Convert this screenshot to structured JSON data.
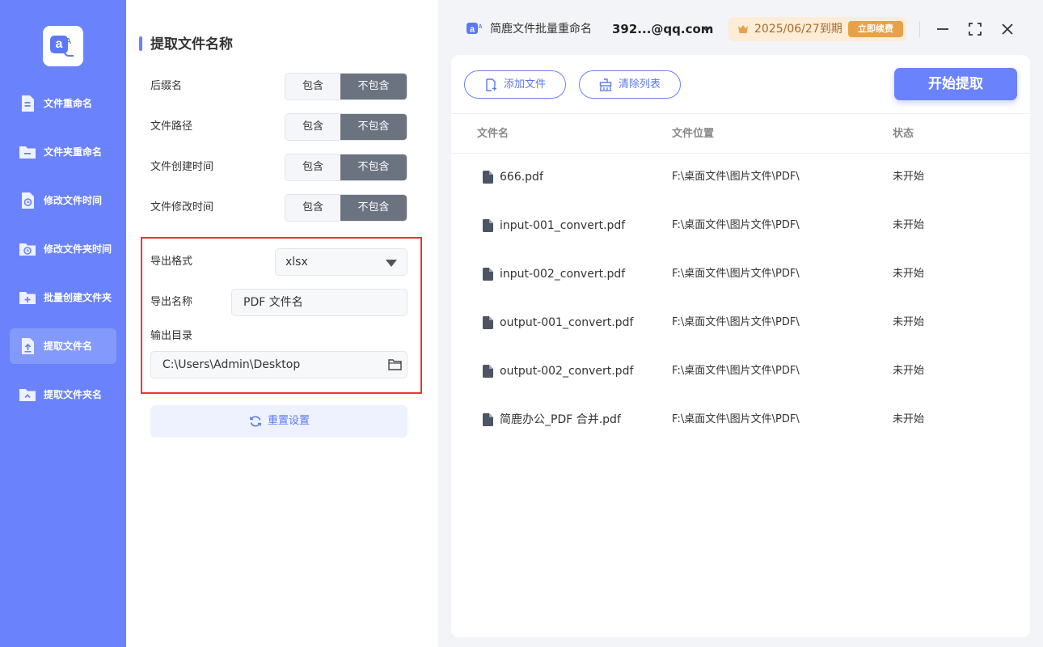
{
  "sidebar": {
    "items": [
      {
        "label": "文件重命名",
        "icon": "rename-file-icon"
      },
      {
        "label": "文件夹重命名",
        "icon": "rename-folder-icon"
      },
      {
        "label": "修改文件时间",
        "icon": "file-time-icon"
      },
      {
        "label": "修改文件夹时间",
        "icon": "folder-time-icon"
      },
      {
        "label": "批量创建文件夹",
        "icon": "create-folder-icon"
      },
      {
        "label": "提取文件名",
        "icon": "extract-filename-icon",
        "active": true
      },
      {
        "label": "提取文件夹名",
        "icon": "extract-foldername-icon"
      }
    ]
  },
  "panel": {
    "title": "提取文件名称",
    "options": [
      {
        "label": "后缀名",
        "include": "包含",
        "exclude": "不包含",
        "selected": "不包含"
      },
      {
        "label": "文件路径",
        "include": "包含",
        "exclude": "不包含",
        "selected": "不包含"
      },
      {
        "label": "文件创建时间",
        "include": "包含",
        "exclude": "不包含",
        "selected": "不包含"
      },
      {
        "label": "文件修改时间",
        "include": "包含",
        "exclude": "不包含",
        "selected": "不包含"
      }
    ],
    "export_format_label": "导出格式",
    "export_format_value": "xlsx",
    "export_name_label": "导出名称",
    "export_name_value": "PDF 文件名",
    "output_dir_label": "输出目录",
    "output_dir_value": "C:\\Users\\Admin\\Desktop",
    "reset_label": "重置设置"
  },
  "topbar": {
    "app_name": "简鹿文件批量重命名",
    "user": "392...@qq.com",
    "expiry": "2025/06/27到期",
    "renew": "立即续费"
  },
  "toolbar": {
    "add_file": "添加文件",
    "clear_list": "清除列表",
    "start": "开始提取"
  },
  "table": {
    "headers": [
      "文件名",
      "文件位置",
      "状态"
    ],
    "rows": [
      {
        "name": "666.pdf",
        "location": "F:\\桌面文件\\图片文件\\PDF\\",
        "status": "未开始"
      },
      {
        "name": "input-001_convert.pdf",
        "location": "F:\\桌面文件\\图片文件\\PDF\\",
        "status": "未开始"
      },
      {
        "name": "input-002_convert.pdf",
        "location": "F:\\桌面文件\\图片文件\\PDF\\",
        "status": "未开始"
      },
      {
        "name": "output-001_convert.pdf",
        "location": "F:\\桌面文件\\图片文件\\PDF\\",
        "status": "未开始"
      },
      {
        "name": "output-002_convert.pdf",
        "location": "F:\\桌面文件\\图片文件\\PDF\\",
        "status": "未开始"
      },
      {
        "name": "简鹿办公_PDF 合并.pdf",
        "location": "F:\\桌面文件\\图片文件\\PDF\\",
        "status": "未开始"
      }
    ]
  },
  "colors": {
    "accent": "#6a82fb",
    "selected_segment": "#6b7280",
    "highlight_border": "#e53935",
    "vip_bg": "#fdecd6",
    "renew_bg": "#e7a14a"
  }
}
